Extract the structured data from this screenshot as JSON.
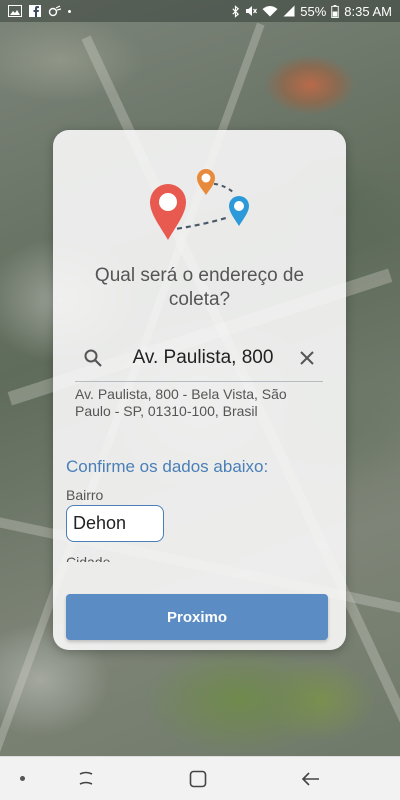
{
  "status_bar": {
    "battery": "55%",
    "time": "8:35 AM"
  },
  "card": {
    "question": "Qual será o endereço de coleta?",
    "search": {
      "value": "Av. Paulista, 800",
      "placeholder": ""
    },
    "suggestion": "Av. Paulista, 800 - Bela Vista, São Paulo - SP, 01310-100, Brasil",
    "confirm_title": "Confirme os dados abaixo:",
    "bairro_label": "Bairro",
    "bairro_value": "Dehon",
    "cidade_label": "Cidade",
    "next_label": "Proximo"
  },
  "colors": {
    "accent": "#5b8cc3",
    "pin_red": "#e85a4f",
    "pin_orange": "#e88a3c",
    "pin_blue": "#2c9ad8"
  },
  "icons": [
    "gallery-icon",
    "facebook-icon",
    "tracking-icon",
    "bluetooth-icon",
    "mute-icon",
    "wifi-icon",
    "signal-icon",
    "battery-icon",
    "search-icon",
    "close-icon",
    "recents-icon",
    "home-icon",
    "back-icon"
  ]
}
